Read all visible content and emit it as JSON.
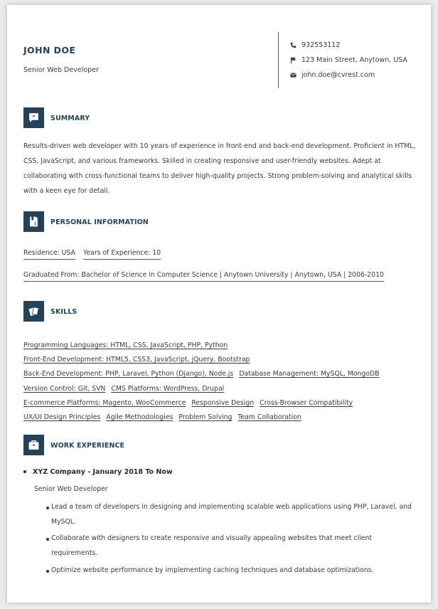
{
  "header": {
    "name": "JOHN DOE",
    "title": "Senior Web Developer",
    "phone": "932553112",
    "address": "123 Main Street, Anytown, USA",
    "email": "john.doe@cvrest.com"
  },
  "sections": {
    "summary": "SUMMARY",
    "personal": "PERSONAL INFORMATION",
    "skills": "SKILLS",
    "work": "WORK EXPERIENCE"
  },
  "summary_text": "Results-driven web developer with 10 years of experience in front-end and back-end development. Proficient in HTML, CSS, JavaScript, and various frameworks. Skilled in creating responsive and user-friendly websites. Adept at collaborating with cross-functional teams to deliver high-quality projects. Strong problem-solving and analytical skills with a keen eye for detail.",
  "personal": {
    "residence": "Residence: USA",
    "experience": "Years of Experience: 10",
    "graduated": "Graduated From: Bachelor of Science in Computer Science | Anytown University | Anytown, USA | 2006-2010"
  },
  "skills": [
    "Programming Languages: HTML, CSS, JavaScript, PHP, Python",
    "Front-End Development: HTML5, CSS3, JavaScript, jQuery, Bootstrap",
    "Back-End Development: PHP, Laravel, Python (Django), Node.js",
    "Database Management: MySQL, MongoDB",
    "Version Control: Git, SVN",
    "CMS Platforms: WordPress, Drupal",
    "E-commerce Platforms: Magento, WooCommerce",
    "Responsive Design",
    "Cross-Browser Compatibility",
    "UX/UI Design Principles",
    "Agile Methodologies",
    "Problem Solving",
    "Team Collaboration"
  ],
  "work": {
    "heading": "XYZ Company - January 2018 To Now",
    "role": "Senior Web Developer",
    "responsibilities": [
      "Lead a team of developers in designing and implementing scalable web applications using PHP, Laravel, and MySQL.",
      "Collaborate with designers to create responsive and visually appealing websites that meet client requirements.",
      "Optimize website performance by implementing caching techniques and database optimizations."
    ]
  },
  "colors": {
    "accent": "#24435a",
    "text": "#3a3a3a",
    "background": "#ebebeb"
  },
  "icons": {
    "phone": "phone-icon",
    "address": "flag-icon",
    "email": "envelope-icon",
    "summary": "quote-icon",
    "personal": "id-card-icon",
    "skills": "cards-icon",
    "work": "briefcase-icon"
  }
}
